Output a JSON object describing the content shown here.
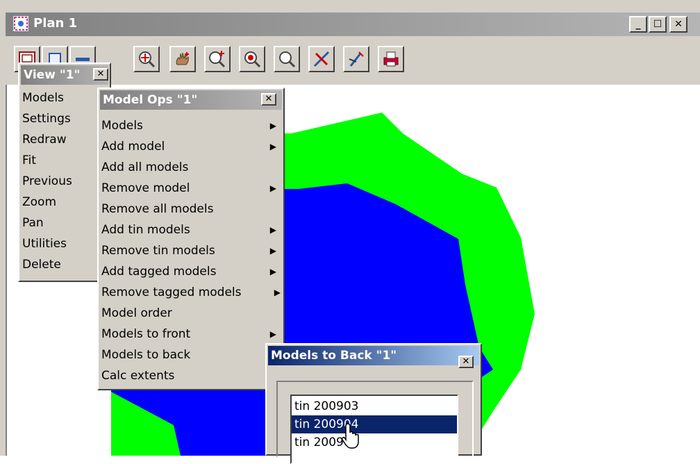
{
  "window": {
    "title": "Plan 1",
    "controls": {
      "minimize": "_",
      "maximize": "☐",
      "close": "✕"
    }
  },
  "toolbar": {
    "buttons": [
      {
        "icon": "view-menu-icon"
      },
      {
        "icon": "model-ops-icon"
      },
      {
        "icon": "settings-icon"
      },
      {
        "icon": "fit-icon"
      },
      {
        "icon": "pan-icon"
      },
      {
        "icon": "zoom-in-icon"
      },
      {
        "icon": "zoom-center-icon"
      },
      {
        "icon": "zoom-out-icon"
      },
      {
        "icon": "delete-icon"
      },
      {
        "icon": "pick-icon"
      },
      {
        "icon": "print-icon"
      }
    ]
  },
  "view_menu": {
    "title": "View \"1\"",
    "close": "✕",
    "items": [
      "Models",
      "Settings",
      "Redraw",
      "Fit",
      "Previous",
      "Zoom",
      "Pan",
      "Utilities",
      "Delete"
    ]
  },
  "model_ops_menu": {
    "title": "Model Ops \"1\"",
    "close": "✕",
    "items": [
      {
        "label": "Models",
        "submenu": true
      },
      {
        "label": "Add model",
        "submenu": true
      },
      {
        "label": "Add all models",
        "submenu": false
      },
      {
        "label": "Remove model",
        "submenu": true
      },
      {
        "label": "Remove all models",
        "submenu": false
      },
      {
        "label": "Add tin models",
        "submenu": true
      },
      {
        "label": "Remove tin models",
        "submenu": true
      },
      {
        "label": "Add tagged models",
        "submenu": true
      },
      {
        "label": "Remove tagged models",
        "submenu": true
      },
      {
        "label": "Model order",
        "submenu": false
      },
      {
        "label": "Models to front",
        "submenu": true
      },
      {
        "label": "Models to back",
        "submenu": false
      },
      {
        "label": "Calc extents",
        "submenu": false
      }
    ],
    "arrow_glyph": "▶"
  },
  "models_to_back_dialog": {
    "title": "Models to Back \"1\"",
    "close": "✕",
    "list": [
      "tin 200903",
      "tin 200904",
      "tin 200905"
    ],
    "selected_index": 1
  },
  "colors": {
    "outer_region": "#00ff00",
    "inner_region": "#0000ff",
    "active_title_start": "#0a246a",
    "active_title_end": "#a6caf0",
    "inactive_title": "#808080",
    "selection": "#0a246a"
  }
}
